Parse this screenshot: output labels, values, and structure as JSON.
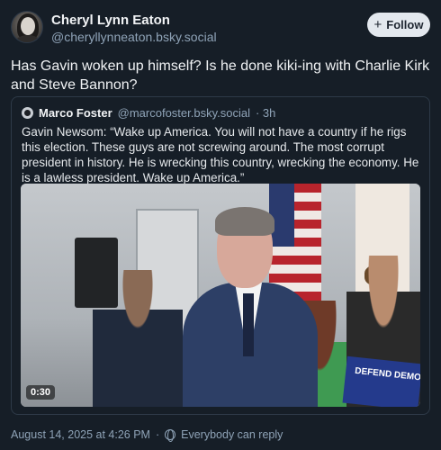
{
  "author": {
    "name": "Cheryl Lynn Eaton",
    "handle": "@cheryllynneaton.bsky.social",
    "avatar_icon": "profile-photo"
  },
  "follow_button": {
    "label": "Follow",
    "icon": "plus-icon"
  },
  "post": {
    "text": "Has Gavin woken up himself? Is he done kiki-ing with Charlie Kirk and Steve Bannon?"
  },
  "quote": {
    "name": "Marco Foster",
    "handle": "@marcofoster.bsky.social",
    "time": "· 3h",
    "text": "Gavin Newsom: “Wake up America. You will not have a country if he rigs this election. These guys are not screwing around. The most corrupt president in history. He is wrecking this country, wrecking the economy. He is a lawless president. Wake up America.”",
    "video": {
      "duration": "0:30",
      "sign_text": "DEFEND DEMO"
    }
  },
  "footer": {
    "date": "August 14, 2025 at 4:26 PM",
    "separator": "·",
    "visibility": "Everybody can reply",
    "visibility_icon": "globe-icon"
  },
  "colors": {
    "background": "#161e27",
    "secondary_text": "#8fa3b7",
    "button_bg": "#e3e8ee"
  }
}
